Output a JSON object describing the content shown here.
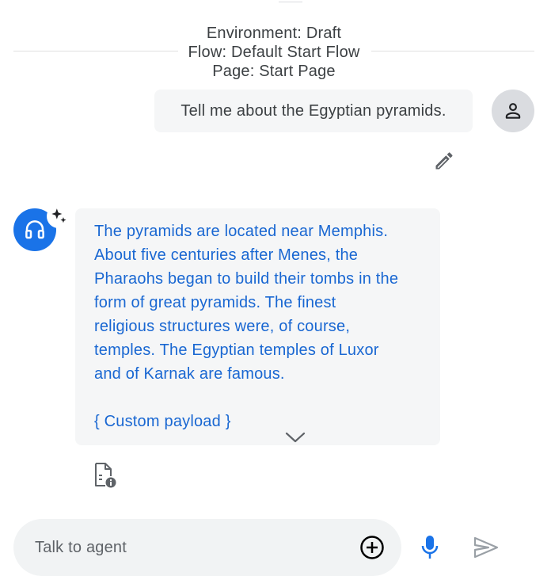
{
  "session": {
    "environment": "Environment: Draft",
    "flow": "Flow: Default Start Flow",
    "page": "Page: Start Page"
  },
  "user_message": {
    "text": "Tell me about the Egyptian pyramids."
  },
  "agent_message": {
    "text": "The pyramids are located near Memphis.\nAbout five centuries after Menes, the\nPharaohs began to build their tombs in the\nform of great pyramids. The finest\nreligious structures were, of course,\ntemples. The Egyptian temples of Luxor\nand of Karnak are famous.",
    "payload_link": "{ Custom payload }"
  },
  "input": {
    "placeholder": "Talk to agent",
    "value": ""
  },
  "colors": {
    "agent_avatar": "#1a73e8",
    "agent_text": "#1967d2",
    "bubble_bg": "#f5f6f7",
    "input_bg": "#f1f3f4",
    "mic": "#1a73e8"
  },
  "icons": {
    "user_avatar": "person-icon",
    "edit": "pencil-icon",
    "agent_avatar": "headset-icon",
    "sparkle": "sparkle-icon",
    "expand": "chevron-down-icon",
    "info_doc": "document-info-icon",
    "add": "add-circle-icon",
    "mic": "mic-icon",
    "send": "send-icon"
  }
}
